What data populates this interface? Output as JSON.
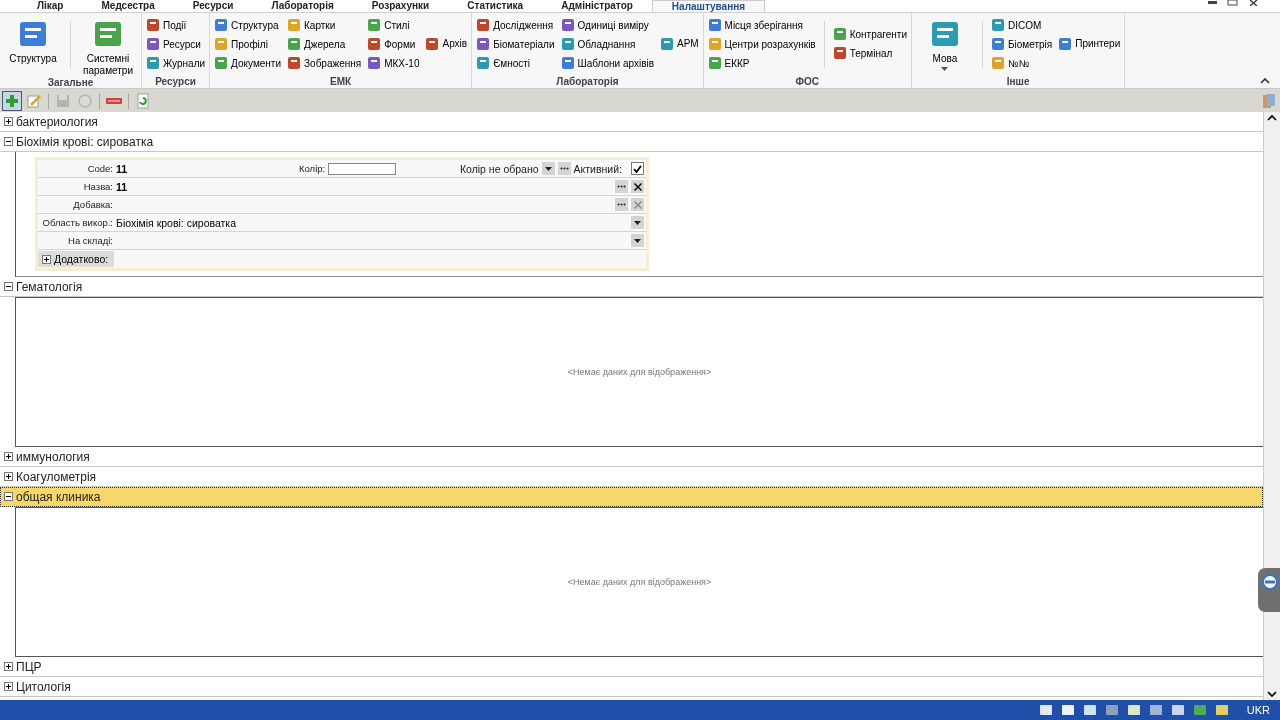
{
  "menu_tabs": [
    {
      "label": "Лікар",
      "selected": false
    },
    {
      "label": "Медсестра",
      "selected": false
    },
    {
      "label": "Ресурси",
      "selected": false
    },
    {
      "label": "Лабораторія",
      "selected": false
    },
    {
      "label": "Розрахунки",
      "selected": false
    },
    {
      "label": "Статистика",
      "selected": false
    },
    {
      "label": "Адміністратор",
      "selected": false
    },
    {
      "label": "Налаштування",
      "selected": true
    }
  ],
  "ribbon": [
    {
      "label": "Загальне",
      "columns": [
        {
          "kind": "large",
          "items": [
            "Структура"
          ]
        },
        {
          "kind": "separator"
        },
        {
          "kind": "large",
          "items": [
            "Системні параметри"
          ]
        }
      ]
    },
    {
      "label": "Ресурси",
      "columns": [
        {
          "kind": "small",
          "items": [
            "Події",
            "Ресурси",
            "Журнали"
          ]
        }
      ]
    },
    {
      "label": "ЕМК",
      "columns": [
        {
          "kind": "small",
          "items": [
            "Структура",
            "Профілі",
            "Документи"
          ]
        },
        {
          "kind": "small",
          "items": [
            "Картки",
            "Джерела",
            "Зображення"
          ]
        },
        {
          "kind": "small",
          "items": [
            "Стилі",
            "Форми",
            "МКХ-10"
          ]
        },
        {
          "kind": "small",
          "items": [
            "Архів"
          ]
        }
      ]
    },
    {
      "label": "Лабораторія",
      "columns": [
        {
          "kind": "small",
          "items": [
            "Дослідження",
            "Біоматеріали",
            "Ємності"
          ]
        },
        {
          "kind": "small",
          "items": [
            "Одиниці виміру",
            "Обладнання",
            "Шаблони архівів"
          ]
        },
        {
          "kind": "small",
          "items": [
            "АРМ"
          ]
        }
      ]
    },
    {
      "label": "ФОС",
      "columns": [
        {
          "kind": "small",
          "items": [
            "Місця зберігання",
            "Центри розрахунків",
            "ЕККР"
          ]
        },
        {
          "kind": "separator"
        },
        {
          "kind": "small",
          "items": [
            "Контрагенти",
            "Термінал"
          ]
        }
      ]
    },
    {
      "label": "Інше",
      "columns": [
        {
          "kind": "large",
          "items": [
            "Мова"
          ]
        },
        {
          "kind": "separator"
        },
        {
          "kind": "small",
          "items": [
            "DICOM",
            "Біометрія",
            "№№"
          ]
        },
        {
          "kind": "small",
          "items": [
            "Принтери"
          ]
        }
      ]
    }
  ],
  "toolbar": [
    {
      "kind": "add",
      "disabled": false,
      "highlighted": true
    },
    {
      "kind": "edit",
      "disabled": false,
      "highlighted": false
    },
    {
      "kind": "separator"
    },
    {
      "kind": "save",
      "disabled": true,
      "highlighted": false
    },
    {
      "kind": "cancel",
      "disabled": true,
      "highlighted": false
    },
    {
      "kind": "separator"
    },
    {
      "kind": "delete",
      "disabled": false,
      "highlighted": false
    },
    {
      "kind": "separator"
    },
    {
      "kind": "refresh",
      "disabled": false,
      "highlighted": false
    }
  ],
  "groups": [
    {
      "label": "бактериология",
      "expanded": false,
      "selected": false
    },
    {
      "label": "Біохімія крові: сироватка",
      "expanded": true,
      "selected": false,
      "content": {
        "kind": "form",
        "rows": [
          {
            "label": "Code:",
            "value": "11",
            "color_label": "Колір:",
            "color_value": "Колір не обрано",
            "active_label": "Активний:",
            "active": true
          },
          {
            "label": "Назва:",
            "value": "11",
            "buttons": [
              {
                "kind": "more",
                "disabled": false
              },
              {
                "kind": "clear",
                "disabled": false
              }
            ]
          },
          {
            "label": "Добавка:",
            "buttons": [
              {
                "kind": "more",
                "disabled": false
              },
              {
                "kind": "clear",
                "disabled": true
              }
            ]
          },
          {
            "label": "Область викор.:",
            "value": "Біохімія крові: сироватка",
            "buttons": [
              {
                "kind": "dropdown",
                "disabled": false
              }
            ]
          },
          {
            "label": "На складі:",
            "buttons": [
              {
                "kind": "dropdown",
                "disabled": false
              }
            ]
          }
        ],
        "section": {
          "label": "Додатково:",
          "expanded": false
        }
      }
    },
    {
      "label": "Гематологія",
      "expanded": true,
      "selected": false,
      "content": {
        "kind": "empty",
        "message": "<Немає даних для відображення>"
      }
    },
    {
      "label": "иммунология",
      "expanded": false,
      "selected": false
    },
    {
      "label": "Коагулометрія",
      "expanded": false,
      "selected": false
    },
    {
      "label": "общая клиника",
      "expanded": true,
      "selected": true,
      "content": {
        "kind": "empty",
        "message": "<Немає даних для відображення>"
      }
    },
    {
      "label": "ПЦР",
      "expanded": false,
      "selected": false
    },
    {
      "label": "Цитологія",
      "expanded": false,
      "selected": false
    }
  ],
  "taskbar": {
    "language": "UKR"
  }
}
